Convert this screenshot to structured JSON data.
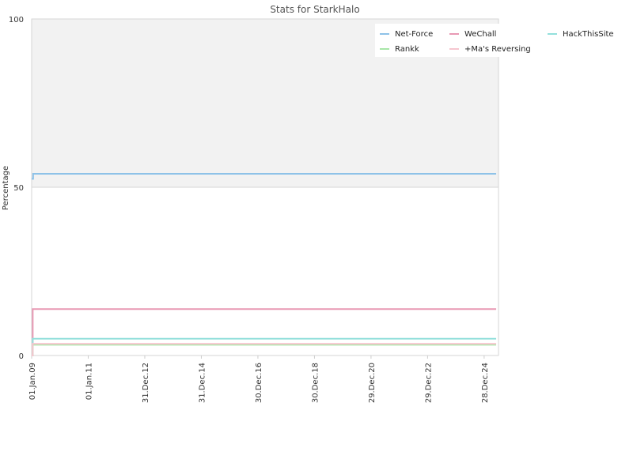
{
  "chart_data": {
    "type": "line",
    "title": "Stats for StarkHalo",
    "xlabel": "",
    "ylabel": "Percentage",
    "ylim": [
      0,
      100
    ],
    "yticks": [
      0,
      50,
      100
    ],
    "xlim": [
      "2009-01-01",
      "2025-07-01"
    ],
    "xticks": [
      {
        "date": "2009-01-01",
        "label": "01.Jan.09"
      },
      {
        "date": "2011-01-01",
        "label": "01.Jan.11"
      },
      {
        "date": "2012-12-31",
        "label": "31.Dec.12"
      },
      {
        "date": "2014-12-31",
        "label": "31.Dec.14"
      },
      {
        "date": "2016-12-30",
        "label": "30.Dec.16"
      },
      {
        "date": "2018-12-30",
        "label": "30.Dec.18"
      },
      {
        "date": "2020-12-29",
        "label": "29.Dec.20"
      },
      {
        "date": "2022-12-29",
        "label": "29.Dec.22"
      },
      {
        "date": "2024-12-28",
        "label": "28.Dec.24"
      }
    ],
    "upper_band": {
      "from": 50,
      "to": 100,
      "color": "#f2f2f2"
    },
    "legend_position": "top-right",
    "series": [
      {
        "name": "Net-Force",
        "color": "#8ec2e8",
        "points": [
          [
            "2009-01-01",
            52.5
          ],
          [
            "2009-01-20",
            54
          ],
          [
            "2025-06-01",
            54
          ]
        ]
      },
      {
        "name": "WeChall",
        "color": "#e899b4",
        "points": [
          [
            "2009-01-01",
            0
          ],
          [
            "2009-01-15",
            13.8
          ],
          [
            "2025-06-01",
            13.8
          ]
        ]
      },
      {
        "name": "HackThisSite",
        "color": "#93e0dc",
        "points": [
          [
            "2009-01-01",
            0
          ],
          [
            "2009-01-15",
            5
          ],
          [
            "2025-06-01",
            5
          ]
        ]
      },
      {
        "name": "Rankk",
        "color": "#a8e6a8",
        "points": [
          [
            "2009-01-01",
            0
          ],
          [
            "2009-01-15",
            3.2
          ],
          [
            "2025-06-01",
            3.2
          ]
        ]
      },
      {
        "name": "+Ma's Reversing",
        "color": "#f6c6cf",
        "points": [
          [
            "2009-01-01",
            0
          ],
          [
            "2009-01-15",
            3.5
          ],
          [
            "2025-06-01",
            3.5
          ]
        ]
      }
    ]
  }
}
